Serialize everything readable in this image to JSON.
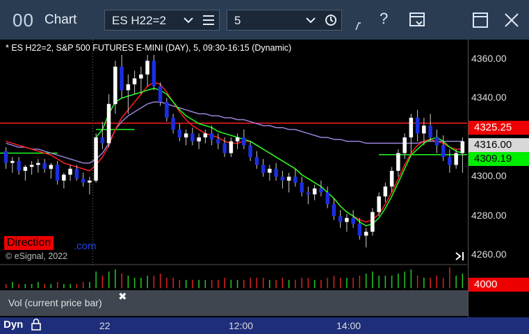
{
  "window": {
    "app_icon": "00",
    "title": "Chart",
    "symbol_value": "ES H22=2",
    "interval_value": "5",
    "icons": [
      "chevron-down-icon",
      "menu-icon",
      "clock-icon",
      "draw-tool-icon",
      "help-icon",
      "window-menu-icon",
      "maximize-icon",
      "close-icon"
    ]
  },
  "legend": {
    "text": "* ES H22=2, S&P 500 FUTURES E-MINI (DAY), 5, 09:30-16:15 (Dynamic)"
  },
  "watermark": {
    "direction_label": "Direction",
    "direction_suffix": ".com",
    "copyright": "© eSignal, 2022"
  },
  "price_axis": {
    "ticks": [
      "4360.00",
      "4340.00",
      "4300.00",
      "4280.00",
      "4260.00"
    ],
    "badges": {
      "resistance": "4325.25",
      "last": "4316.00",
      "ma": "4309.19",
      "volume": "4000"
    },
    "colors": {
      "resistance": "#ff0000",
      "last": "#ffffff",
      "ma": "#00ff00",
      "volume": "#ff0000"
    }
  },
  "volume_panel": {
    "label": "Vol (current price bar)",
    "close_glyph": "✖"
  },
  "time_axis": {
    "dyn_label": "Dyn",
    "ticks": [
      "22",
      "12:00",
      "14:00"
    ]
  },
  "chart_data": {
    "type": "candlestick",
    "ylim": [
      4254,
      4366
    ],
    "colors": {
      "up": "#ffffff",
      "down": "#1b2ee0",
      "red": "#ff2020",
      "green": "#22ff22",
      "purple": "#9a82d8"
    },
    "candles": [
      [
        4311,
        4313,
        4302,
        4305
      ],
      [
        4305,
        4308,
        4300,
        4306
      ],
      [
        4306,
        4308,
        4299,
        4301
      ],
      [
        4301,
        4304,
        4296,
        4303
      ],
      [
        4303,
        4306,
        4299,
        4304
      ],
      [
        4304,
        4307,
        4300,
        4305
      ],
      [
        4305,
        4307,
        4300,
        4302
      ],
      [
        4302,
        4305,
        4297,
        4304
      ],
      [
        4304,
        4306,
        4294,
        4296
      ],
      [
        4296,
        4300,
        4292,
        4299
      ],
      [
        4299,
        4304,
        4296,
        4302
      ],
      [
        4302,
        4304,
        4296,
        4297
      ],
      [
        4297,
        4300,
        4293,
        4295
      ],
      [
        4295,
        4298,
        4289,
        4296
      ],
      [
        4296,
        4320,
        4295,
        4318
      ],
      [
        4318,
        4326,
        4312,
        4315
      ],
      [
        4315,
        4340,
        4313,
        4335
      ],
      [
        4335,
        4357,
        4330,
        4354
      ],
      [
        4354,
        4360,
        4338,
        4342
      ],
      [
        4342,
        4350,
        4330,
        4345
      ],
      [
        4345,
        4352,
        4340,
        4348
      ],
      [
        4348,
        4354,
        4340,
        4350
      ],
      [
        4350,
        4360,
        4344,
        4357
      ],
      [
        4357,
        4360,
        4342,
        4344
      ],
      [
        4344,
        4346,
        4334,
        4336
      ],
      [
        4336,
        4338,
        4326,
        4328
      ],
      [
        4328,
        4330,
        4320,
        4322
      ],
      [
        4322,
        4325,
        4316,
        4318
      ],
      [
        4318,
        4322,
        4314,
        4320
      ],
      [
        4320,
        4323,
        4314,
        4316
      ],
      [
        4316,
        4320,
        4312,
        4318
      ],
      [
        4318,
        4322,
        4315,
        4320
      ],
      [
        4320,
        4324,
        4314,
        4317
      ],
      [
        4317,
        4320,
        4312,
        4315
      ],
      [
        4315,
        4318,
        4308,
        4310
      ],
      [
        4310,
        4318,
        4308,
        4316
      ],
      [
        4316,
        4320,
        4312,
        4318
      ],
      [
        4318,
        4322,
        4312,
        4314
      ],
      [
        4314,
        4316,
        4306,
        4308
      ],
      [
        4308,
        4311,
        4302,
        4304
      ],
      [
        4304,
        4307,
        4298,
        4300
      ],
      [
        4300,
        4304,
        4296,
        4302
      ],
      [
        4302,
        4305,
        4296,
        4298
      ],
      [
        4298,
        4301,
        4292,
        4296
      ],
      [
        4296,
        4300,
        4290,
        4298
      ],
      [
        4298,
        4302,
        4293,
        4295
      ],
      [
        4295,
        4298,
        4288,
        4290
      ],
      [
        4290,
        4293,
        4284,
        4289
      ],
      [
        4289,
        4294,
        4286,
        4292
      ],
      [
        4292,
        4296,
        4288,
        4290
      ],
      [
        4290,
        4293,
        4282,
        4284
      ],
      [
        4284,
        4287,
        4276,
        4278
      ],
      [
        4278,
        4281,
        4272,
        4275
      ],
      [
        4275,
        4279,
        4270,
        4277
      ],
      [
        4277,
        4281,
        4272,
        4274
      ],
      [
        4274,
        4277,
        4266,
        4268
      ],
      [
        4268,
        4272,
        4262,
        4270
      ],
      [
        4270,
        4282,
        4268,
        4280
      ],
      [
        4280,
        4290,
        4278,
        4288
      ],
      [
        4288,
        4295,
        4285,
        4293
      ],
      [
        4293,
        4303,
        4290,
        4301
      ],
      [
        4301,
        4312,
        4298,
        4310
      ],
      [
        4310,
        4320,
        4307,
        4318
      ],
      [
        4318,
        4330,
        4310,
        4328
      ],
      [
        4328,
        4332,
        4316,
        4320
      ],
      [
        4320,
        4328,
        4314,
        4324
      ],
      [
        4324,
        4330,
        4316,
        4318
      ],
      [
        4318,
        4322,
        4310,
        4314
      ],
      [
        4314,
        4319,
        4306,
        4308
      ],
      [
        4308,
        4312,
        4300,
        4304
      ],
      [
        4304,
        4312,
        4302,
        4310
      ],
      [
        4310,
        4318,
        4300,
        4316
      ]
    ],
    "lines": {
      "red_ma": [
        4316,
        4315,
        4314,
        4313,
        4312,
        4311,
        4310,
        4309,
        4307,
        4305,
        4304,
        4303,
        4302,
        4301,
        4304,
        4308,
        4314,
        4322,
        4328,
        4332,
        4336,
        4340,
        4344,
        4346,
        4345,
        4341,
        4336,
        4331,
        4327,
        4324,
        4322,
        4320,
        4319,
        4318,
        4316,
        4315,
        4315,
        4316,
        4316,
        4314,
        4312,
        4310,
        4308,
        4306,
        4304,
        4302,
        4299,
        4297,
        4295,
        4293,
        4290,
        4287,
        4283,
        4280,
        4278,
        4276,
        4275,
        4276,
        4279,
        4284,
        4290,
        4297,
        4304,
        4310,
        4314,
        4316,
        4317,
        4316,
        4315,
        4313,
        4312,
        4312
      ],
      "green_ma": [
        null,
        null,
        null,
        null,
        null,
        null,
        null,
        null,
        null,
        null,
        null,
        null,
        null,
        null,
        4318,
        4322,
        4330,
        4336,
        4338,
        4339,
        4340,
        4341,
        4342,
        4343,
        4342,
        4340,
        4336,
        4332,
        4329,
        4327,
        4325,
        4324,
        4323,
        4321,
        4320,
        4319,
        4318,
        4317,
        4316,
        4314,
        4312,
        4310,
        4308,
        4306,
        4304,
        4302,
        4299,
        4297,
        4295,
        4293,
        4290,
        4287,
        4283,
        4280,
        4278,
        4275,
        4273,
        4274,
        4277,
        4282,
        4288,
        4295,
        4302,
        4309,
        4312,
        4315,
        4317,
        4318,
        4316,
        4313,
        4311,
        4310
      ],
      "purple_ma": [
        4315,
        4314,
        4313,
        4313,
        4312,
        4312,
        4311,
        4310,
        4309,
        4308,
        4307,
        4306,
        4305,
        4305,
        4307,
        4310,
        4315,
        4322,
        4326,
        4329,
        4331,
        4333,
        4335,
        4336,
        4336,
        4335,
        4334,
        4333,
        4332,
        4331,
        4330,
        4330,
        4329,
        4329,
        4328,
        4328,
        4327,
        4327,
        4326,
        4325,
        4324,
        4324,
        4323,
        4323,
        4322,
        4322,
        4321,
        4320,
        4319,
        4318,
        4318,
        4317,
        4317,
        4316,
        4316,
        4316,
        4315,
        4315,
        4315,
        4315,
        4315,
        4315,
        4315,
        4315,
        4315,
        4316,
        4316,
        4316,
        4316,
        4316,
        4316,
        4316
      ]
    },
    "hlines": {
      "resistance": 4325.25,
      "last": 4316.0,
      "ma": 4309.19
    },
    "volume": [
      2,
      3,
      2,
      2,
      2,
      3,
      2,
      2,
      3,
      2,
      2,
      2,
      3,
      3,
      8,
      6,
      8,
      9,
      7,
      6,
      5,
      5,
      6,
      6,
      7,
      5,
      5,
      4,
      4,
      4,
      4,
      4,
      4,
      4,
      5,
      4,
      4,
      4,
      5,
      5,
      5,
      4,
      4,
      5,
      4,
      4,
      5,
      5,
      4,
      4,
      5,
      6,
      5,
      5,
      5,
      6,
      7,
      8,
      6,
      6,
      6,
      7,
      8,
      9,
      6,
      5,
      5,
      6,
      5,
      10,
      6,
      7
    ],
    "vol_max": 10
  }
}
